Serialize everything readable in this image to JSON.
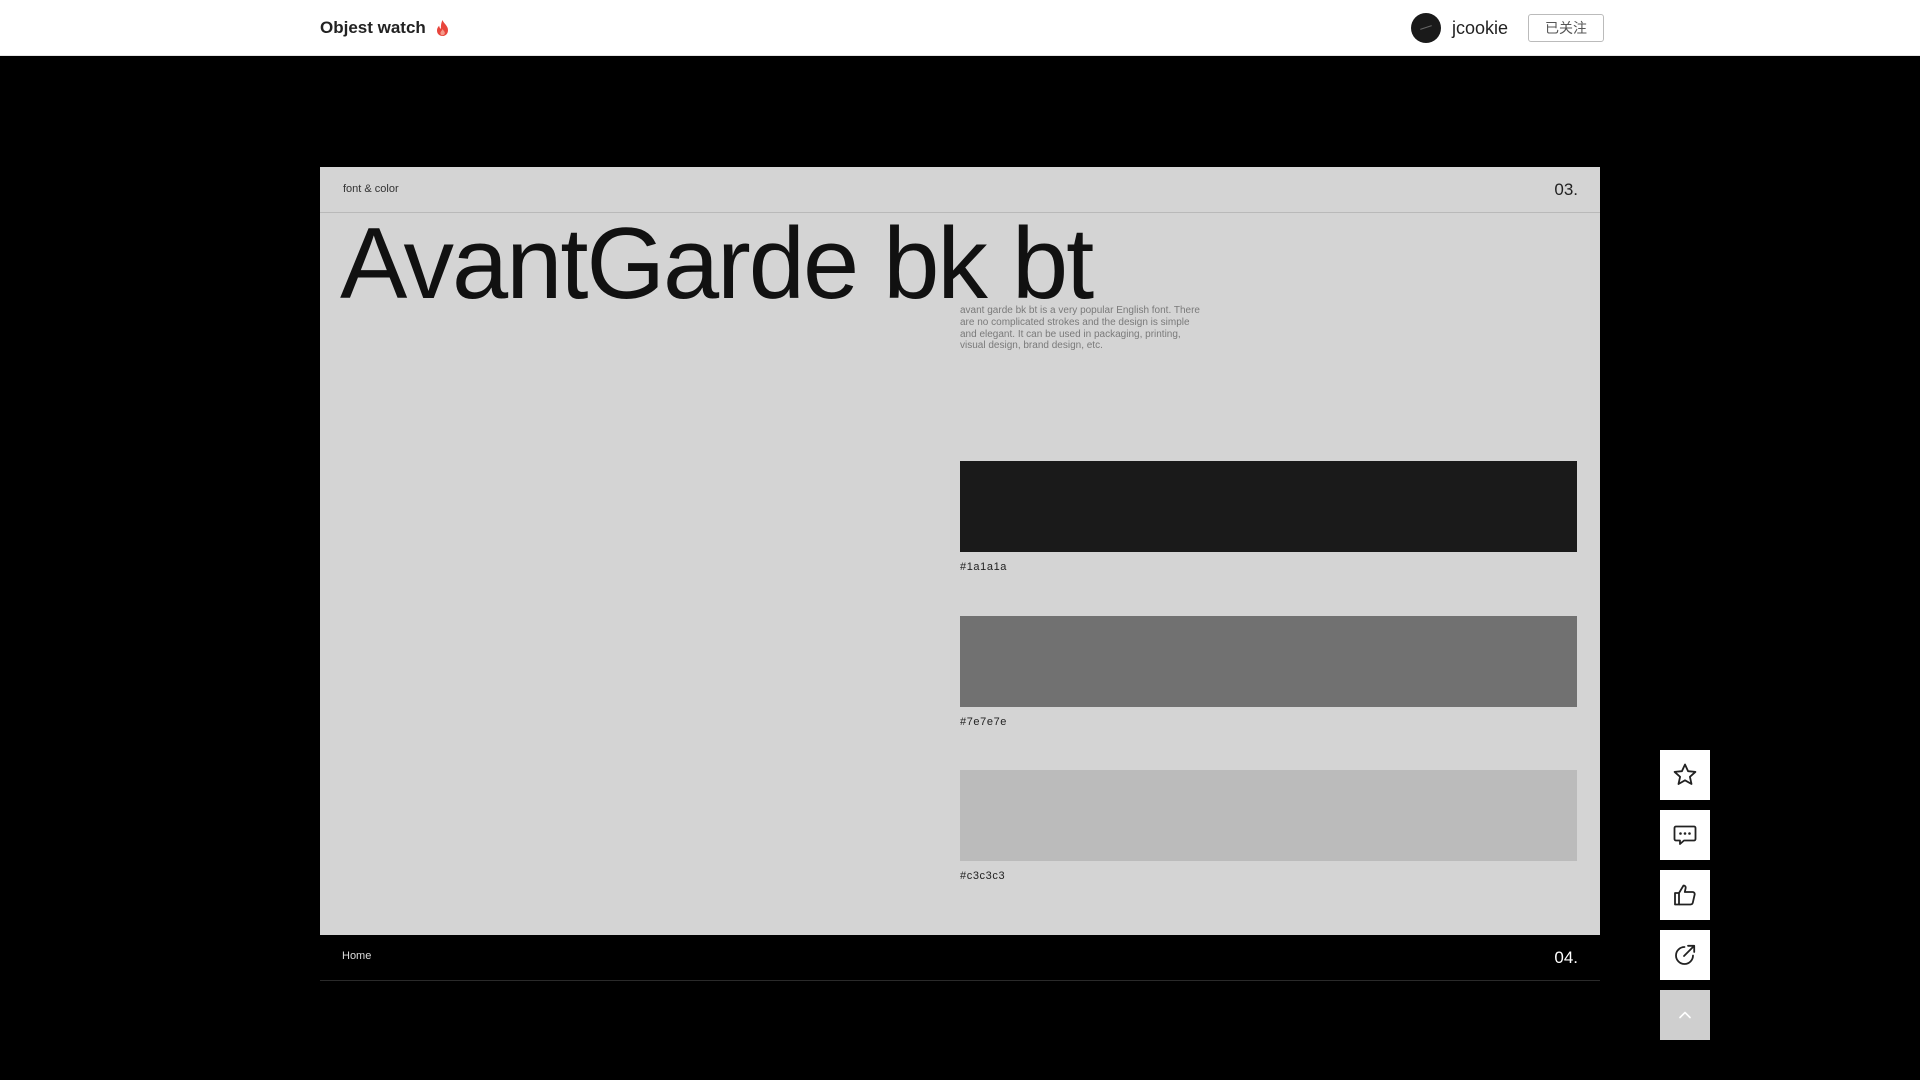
{
  "header": {
    "site_title": "Objest watch",
    "username": "jcookie",
    "follow_label": "已关注"
  },
  "slide": {
    "section_label": "font & color",
    "page_number": "03.",
    "font_name": "AvantGarde bk bt",
    "description": "avant garde bk bt is a very popular English font. There are no complicated strokes and the design is simple and elegant. It can be used in packaging, printing, visual design, brand design, etc.",
    "swatches": [
      {
        "label": "#1a1a1a",
        "color": "#1a1a1a"
      },
      {
        "label": "#7e7e7e",
        "color": "#717171"
      },
      {
        "label": "#c3c3c3",
        "color": "#bbbbbb"
      }
    ]
  },
  "next_slide": {
    "label": "Home",
    "page_number": "04."
  },
  "actions": [
    {
      "name": "star-icon"
    },
    {
      "name": "comment-icon"
    },
    {
      "name": "thumbs-up-icon"
    },
    {
      "name": "share-icon"
    },
    {
      "name": "chevron-up-icon"
    }
  ],
  "colors": {
    "background": "#000000",
    "slide_bg": "#d4d4d4",
    "accent_fire": "#e8453c"
  }
}
